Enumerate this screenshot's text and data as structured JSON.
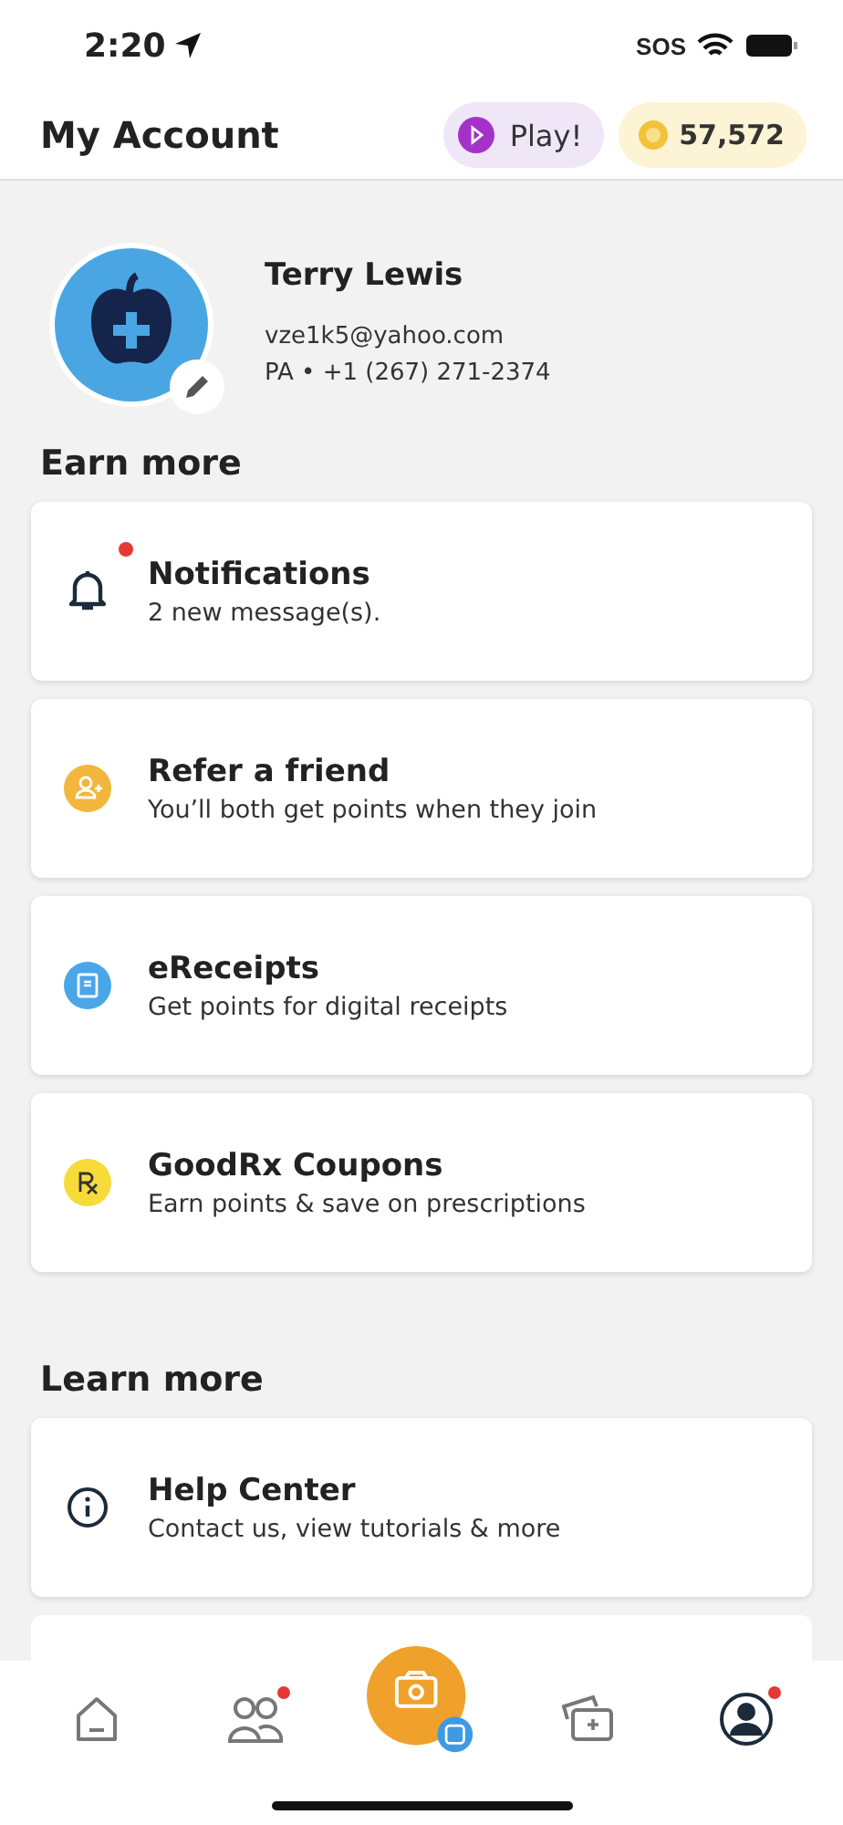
{
  "status_bar": {
    "time": "2:20",
    "sos": "SOS"
  },
  "header": {
    "title": "My Account",
    "play_button": "Play!",
    "points": "57,572"
  },
  "profile": {
    "name": "Terry Lewis",
    "email": "vze1k5@yahoo.com",
    "details": "PA • +1 (267) 271-2374"
  },
  "sections": [
    {
      "title": "Earn more",
      "items": [
        {
          "kind": "bell",
          "title": "Notifications",
          "subtitle": "2 new message(s).",
          "unread": true
        },
        {
          "kind": "friend",
          "title": "Refer a friend",
          "subtitle": "You’ll both get points when they join",
          "unread": false
        },
        {
          "kind": "receipt",
          "title": "eReceipts",
          "subtitle": "Get points for digital receipts",
          "unread": false
        },
        {
          "kind": "rx",
          "title": "GoodRx Coupons",
          "subtitle": "Earn points & save on prescriptions",
          "unread": false
        }
      ]
    },
    {
      "title": "Learn more",
      "items": [
        {
          "kind": "info",
          "title": "Help Center",
          "subtitle": "Contact us, view tutorials & more",
          "unread": false
        }
      ]
    }
  ],
  "tab_bar": [
    {
      "kind": "home",
      "selected": false,
      "unread": false
    },
    {
      "kind": "friends",
      "selected": false,
      "unread": true
    },
    {
      "kind": "camera",
      "selected": false,
      "unread": false
    },
    {
      "kind": "cards",
      "selected": false,
      "unread": false
    },
    {
      "kind": "profile",
      "selected": true,
      "unread": true
    }
  ]
}
